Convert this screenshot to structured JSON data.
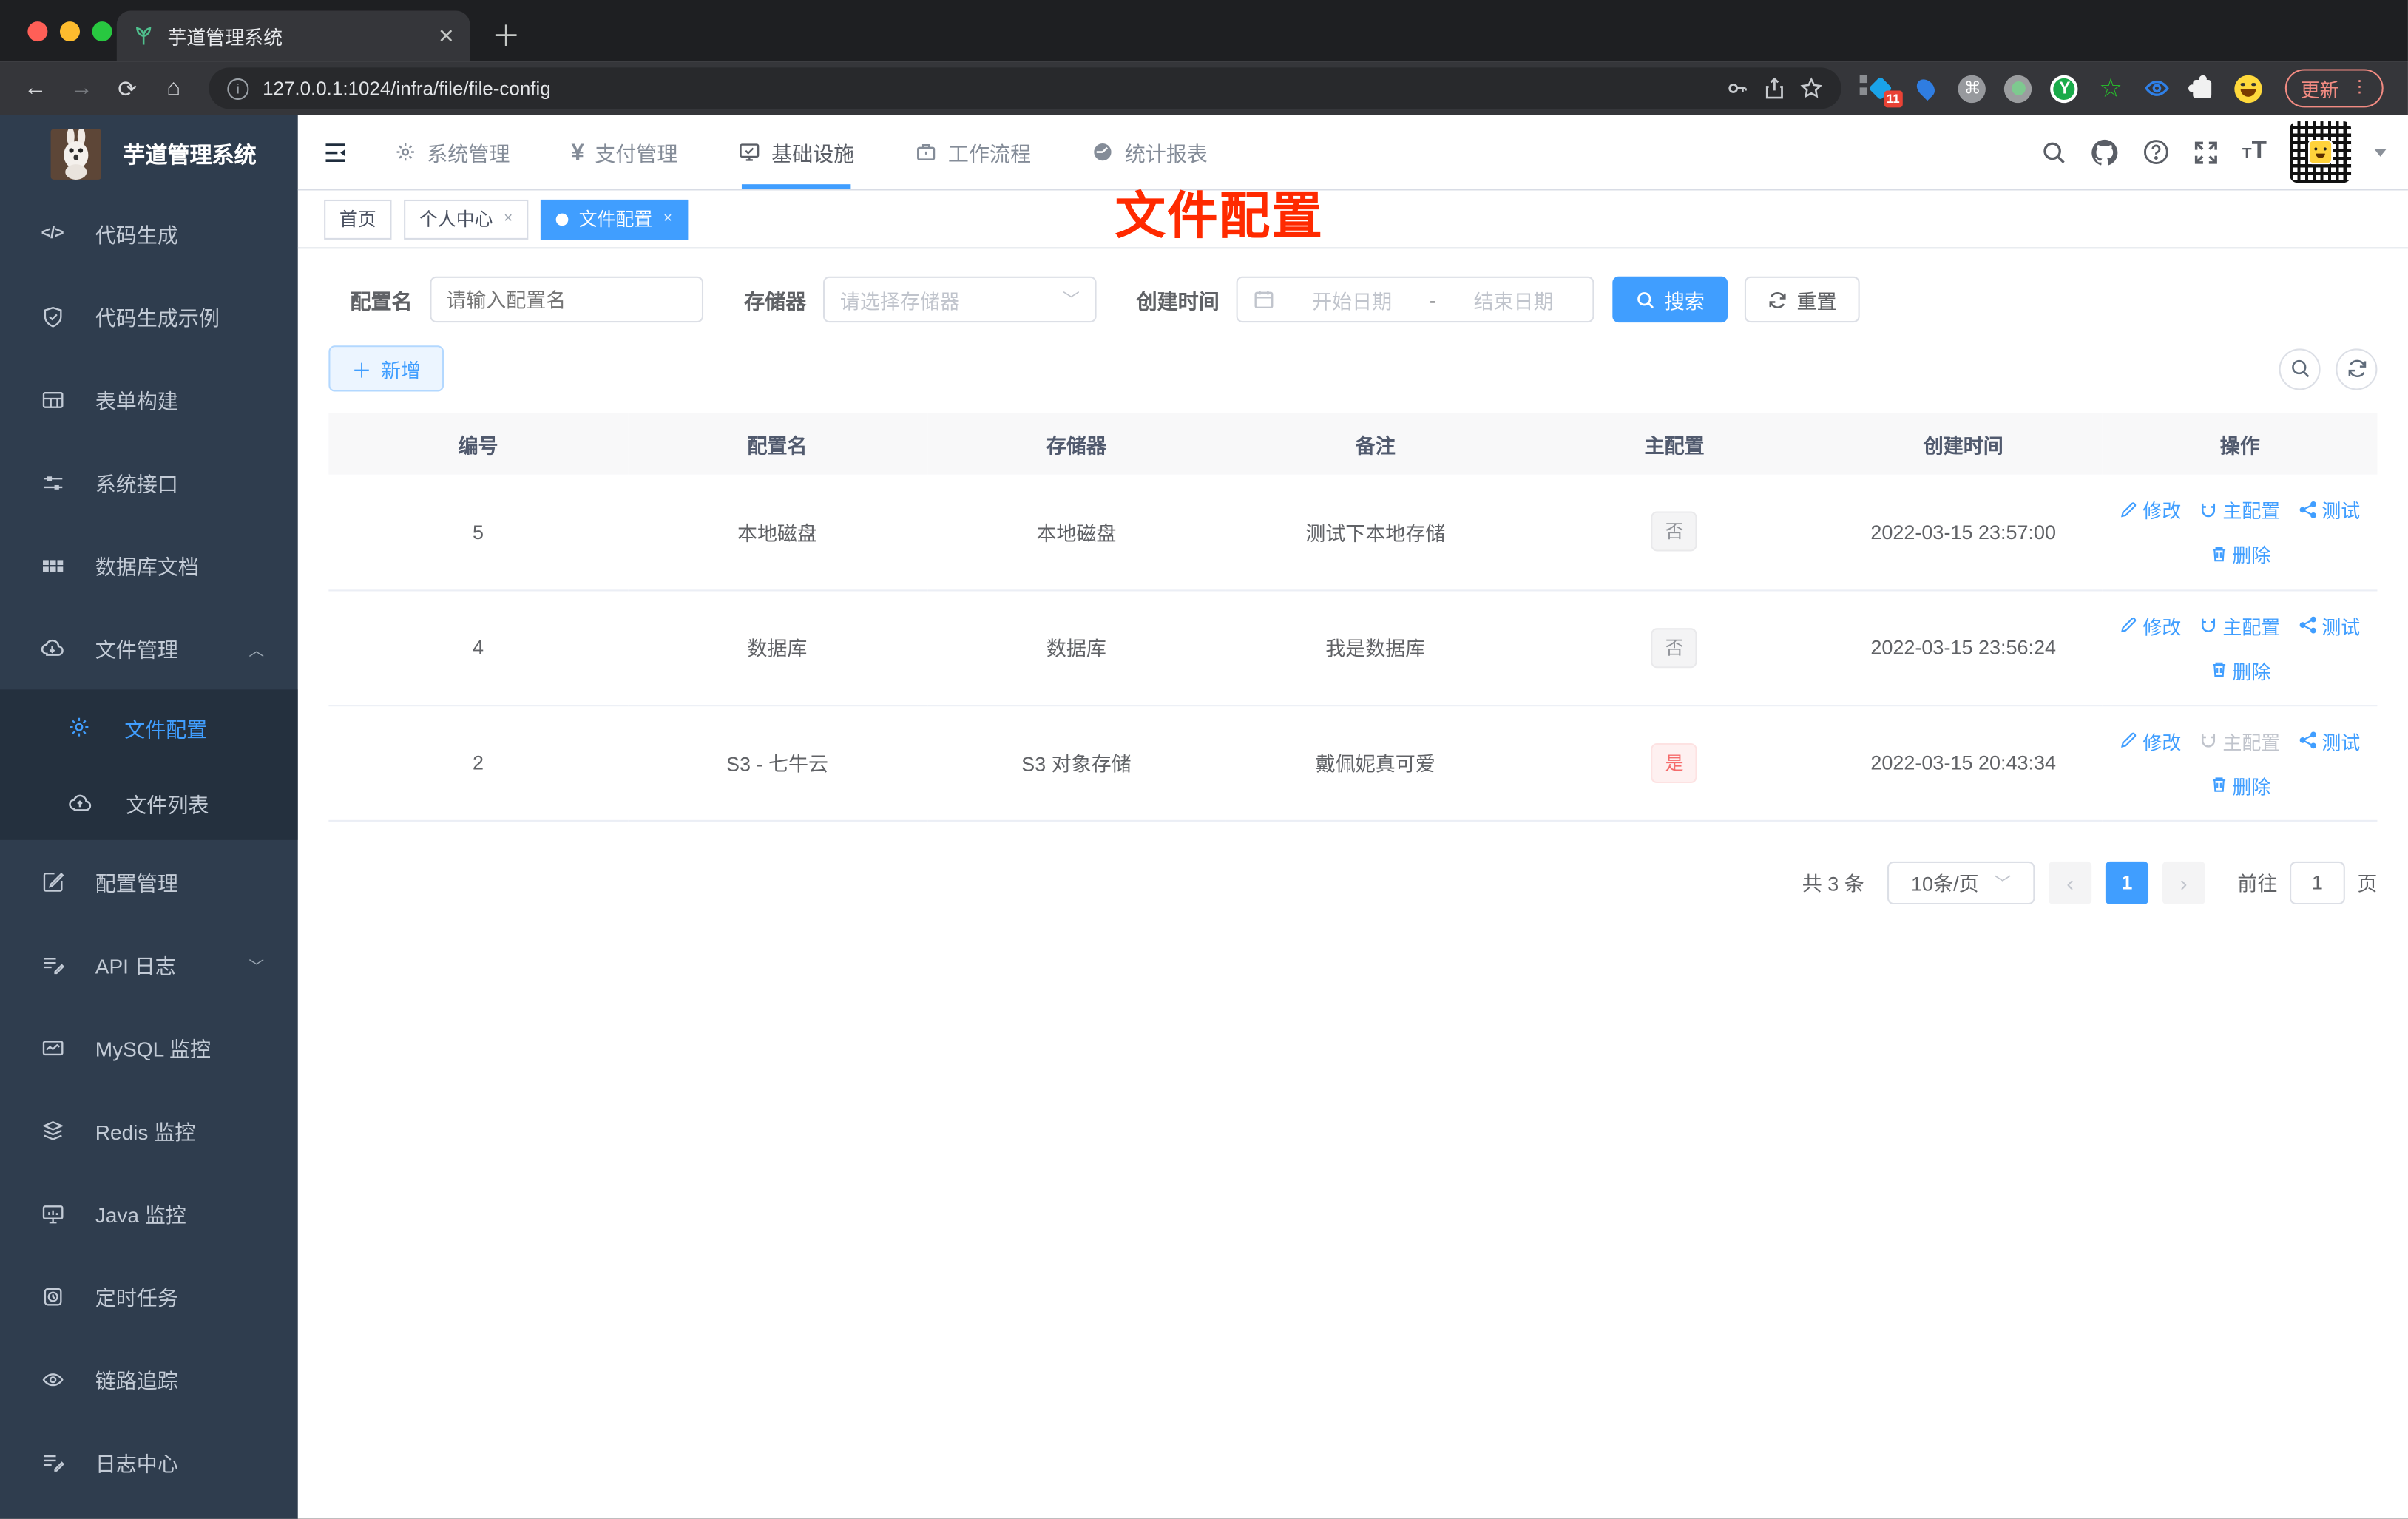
{
  "browser": {
    "tab_title": "芋道管理系统",
    "close_glyph": "✕",
    "new_tab_glyph": "＋",
    "back_glyph": "←",
    "forward_glyph": "→",
    "reload_glyph": "⟳",
    "home_glyph": "⌂",
    "info_glyph": "i",
    "url": "127.0.0.1:1024/infra/file/file-config",
    "extension_badge": "11",
    "cmd_glyph": "⌘",
    "y_ext_letter": "Y",
    "star_ext_glyph": "☆",
    "update_label": "更新",
    "kebab_glyph": "⋮"
  },
  "sidebar": {
    "logo_title": "芋道管理系统",
    "code_glyph": "</>",
    "menu_top": [
      "代码生成",
      "代码生成示例",
      "表单构建",
      "系统接口",
      "数据库文档",
      "文件管理"
    ],
    "chevron_up": "︿",
    "chevron_down": "﹀",
    "submenu": [
      "文件配置",
      "文件列表"
    ],
    "menu_bottom": [
      "配置管理",
      "API 日志",
      "MySQL 监控",
      "Redis 监控",
      "Java 监控",
      "定时任务",
      "链路追踪",
      "日志中心"
    ]
  },
  "topnav": {
    "yen_glyph": "¥",
    "items": [
      "系统管理",
      "支付管理",
      "基础设施",
      "工作流程",
      "统计报表"
    ],
    "font_small": "T",
    "font_large": "T"
  },
  "tabs": [
    {
      "label": "首页"
    },
    {
      "label": "个人中心",
      "close": "×"
    },
    {
      "label": "文件配置",
      "close": "×"
    }
  ],
  "annotation": "文件配置",
  "filters": {
    "name_label": "配置名",
    "name_placeholder": "请输入配置名",
    "storage_label": "存储器",
    "storage_placeholder": "请选择存储器",
    "select_caret": "﹀",
    "date_label": "创建时间",
    "date_start_placeholder": "开始日期",
    "date_separator": "-",
    "date_end_placeholder": "结束日期",
    "search_label": "搜索",
    "reset_label": "重置"
  },
  "toolbar": {
    "add_label": "新增",
    "plus_glyph": "＋"
  },
  "table": {
    "headers": [
      "编号",
      "配置名",
      "存储器",
      "备注",
      "主配置",
      "创建时间",
      "操作"
    ],
    "actions": {
      "edit": "修改",
      "master": "主配置",
      "test": "测试",
      "delete": "删除"
    },
    "rows": [
      {
        "id": "5",
        "name": "本地磁盘",
        "storage": "本地磁盘",
        "remark": "测试下本地存储",
        "master": "否",
        "created": "2022-03-15 23:57:00"
      },
      {
        "id": "4",
        "name": "数据库",
        "storage": "数据库",
        "remark": "我是数据库",
        "master": "否",
        "created": "2022-03-15 23:56:24"
      },
      {
        "id": "2",
        "name": "S3 - 七牛云",
        "storage": "S3 对象存储",
        "remark": "戴佩妮真可爱",
        "master": "是",
        "created": "2022-03-15 20:43:34"
      }
    ]
  },
  "pagination": {
    "total": "共 3 条",
    "page_size": "10条/页",
    "prev_glyph": "‹",
    "next_glyph": "›",
    "current_page": "1",
    "goto_label": "前往",
    "goto_value": "1",
    "page_unit": "页"
  },
  "colors": {
    "accent": "#409eff",
    "sidebar_bg": "#2f3d4e",
    "submenu_bg": "#24303e",
    "annotation_red": "#ff2a00",
    "tag_info_text": "#909399",
    "tag_danger_text": "#f56c6c"
  }
}
